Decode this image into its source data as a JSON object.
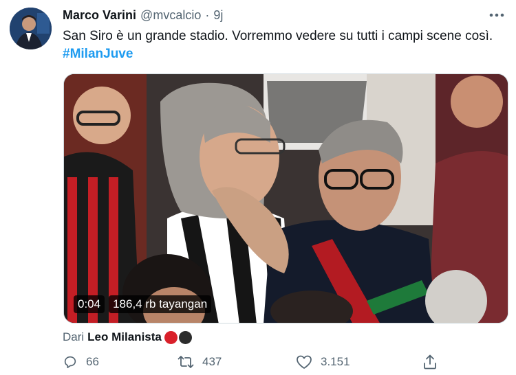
{
  "author": {
    "name": "Marco Varini",
    "handle": "@mvcalcio",
    "separator": "·",
    "time": "9j"
  },
  "tweet": {
    "text": "San Siro è un grande stadio. Vorremmo vedere su tutti i campi scene così.",
    "hashtag": "#MilanJuve"
  },
  "media": {
    "duration": "0:04",
    "views": "186,4 rb tayangan"
  },
  "source": {
    "prefix": "Dari",
    "name": "Leo Milanista",
    "badge_colors": [
      "#d9202a",
      "#2c2c2c"
    ]
  },
  "actions": {
    "replies": "66",
    "retweets": "437",
    "likes": "3.151"
  },
  "icons": [
    "more-icon",
    "reply-icon",
    "retweet-icon",
    "like-icon",
    "share-icon"
  ],
  "colors": {
    "link": "#1d9bf0",
    "secondary_text": "#536471",
    "primary_text": "#0f1419"
  }
}
